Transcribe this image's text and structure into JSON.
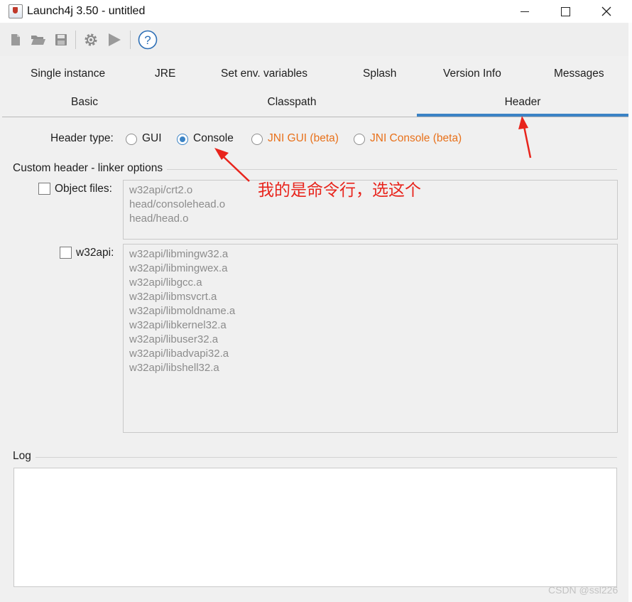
{
  "window": {
    "title": "Launch4j 3.50 - untitled"
  },
  "toolbar": {
    "icons": [
      "new-file-icon",
      "open-folder-icon",
      "save-disk-icon",
      "gear-icon",
      "run-play-icon",
      "help-icon"
    ],
    "help_glyph": "?"
  },
  "tabs": {
    "row1": [
      "Single instance",
      "JRE",
      "Set env. variables",
      "Splash",
      "Version Info",
      "Messages"
    ],
    "row2": [
      "Basic",
      "Classpath",
      "Header"
    ],
    "active": "Header",
    "accent_color": "#3b83c5"
  },
  "header_type": {
    "label": "Header type:",
    "options": [
      "GUI",
      "Console",
      "JNI GUI (beta)",
      "JNI Console (beta)"
    ],
    "selected": "Console",
    "beta_color": "#e8711b"
  },
  "linker": {
    "title": "Custom header - linker options",
    "object_files_label": "Object files:",
    "object_files": [
      "w32api/crt2.o",
      "head/consolehead.o",
      "head/head.o"
    ],
    "w32api_label": "w32api:",
    "w32api_libs": [
      "w32api/libmingw32.a",
      "w32api/libmingwex.a",
      "w32api/libgcc.a",
      "w32api/libmsvcrt.a",
      "w32api/libmoldname.a",
      "w32api/libkernel32.a",
      "w32api/libuser32.a",
      "w32api/libadvapi32.a",
      "w32api/libshell32.a"
    ]
  },
  "log": {
    "title": "Log"
  },
  "annotation": {
    "text": "我的是命令行，选这个",
    "color": "#e8241c"
  },
  "watermark": "CSDN @ssl226"
}
